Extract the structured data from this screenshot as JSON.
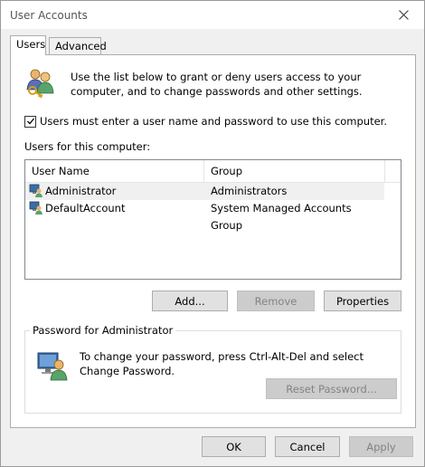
{
  "window": {
    "title": "User Accounts"
  },
  "tabs": [
    {
      "label": "Users",
      "active": true
    },
    {
      "label": "Advanced",
      "active": false
    }
  ],
  "intro": {
    "text": "Use the list below to grant or deny users access to your computer, and to change passwords and other settings."
  },
  "require_login": {
    "label": "Users must enter a user name and password to use this computer.",
    "checked": true
  },
  "users": {
    "label": "Users for this computer:",
    "columns": [
      "User Name",
      "Group"
    ],
    "rows": [
      {
        "name": "Administrator",
        "group": "Administrators",
        "selected": true
      },
      {
        "name": "DefaultAccount",
        "group": "System Managed Accounts Group",
        "selected": false
      }
    ]
  },
  "user_buttons": {
    "add": "Add...",
    "remove": "Remove",
    "properties": "Properties"
  },
  "password": {
    "legend": "Password for Administrator",
    "text": "To change your password, press Ctrl-Alt-Del and select Change Password.",
    "reset": "Reset Password..."
  },
  "footer": {
    "ok": "OK",
    "cancel": "Cancel",
    "apply": "Apply"
  },
  "colors": {
    "window_bg": "#f0f0f0",
    "panel_bg": "#ffffff",
    "button_bg": "#e1e1e1",
    "disabled_text": "#838383"
  }
}
